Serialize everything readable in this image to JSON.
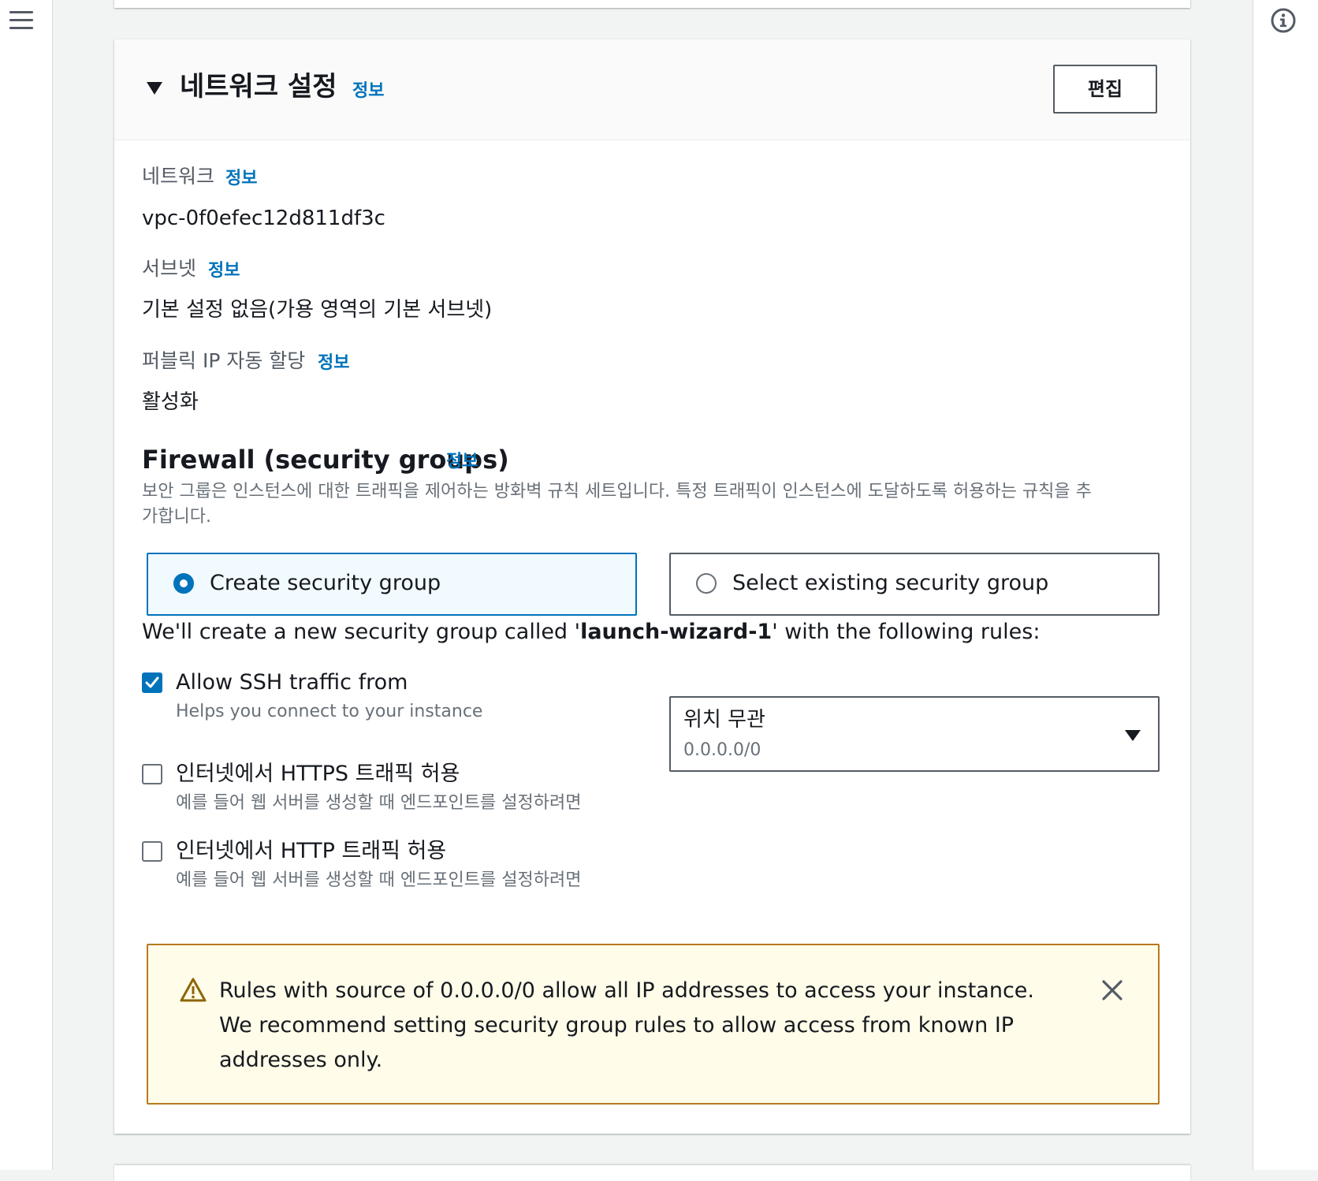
{
  "nav": {
    "menu_icon": "hamburger-menu-icon",
    "info_icon": "info-circle-icon"
  },
  "section": {
    "title": "네트워크 설정",
    "info_link": "정보",
    "edit_label": "편집"
  },
  "fields": {
    "network": {
      "label": "네트워크",
      "info": "정보",
      "value": "vpc-0f0efec12d811df3c"
    },
    "subnet": {
      "label": "서브넷",
      "info": "정보",
      "value": "기본 설정 없음(가용 영역의 기본 서브넷)"
    },
    "public_ip": {
      "label": "퍼블릭 IP 자동 할당",
      "info": "정보",
      "value": "활성화"
    }
  },
  "firewall": {
    "title": "Firewall (security groups)",
    "info": "정보",
    "description": "보안 그룹은 인스턴스에 대한 트래픽을 제어하는 방화벽 규칙 세트입니다. 특정 트래픽이 인스턴스에 도달하도록 허용하는 규칙을 추가합니다.",
    "options": {
      "create": {
        "label": "Create security group",
        "selected": true
      },
      "existing": {
        "label": "Select existing security group",
        "selected": false
      }
    },
    "intro": {
      "prefix": "We'll create a new security group called '",
      "group_name": "launch-wizard-1",
      "suffix": "' with the following rules:"
    },
    "rules": {
      "ssh": {
        "label": "Allow SSH traffic from",
        "description": "Helps you connect to your instance",
        "checked": true
      },
      "https": {
        "label": "인터넷에서 HTTPS 트래픽 허용",
        "description": "예를 들어 웹 서버를 생성할 때 엔드포인트를 설정하려면",
        "checked": false
      },
      "http": {
        "label": "인터넷에서 HTTP 트래픽 허용",
        "description": "예를 들어 웹 서버를 생성할 때 엔드포인트를 설정하려면",
        "checked": false
      }
    },
    "ssh_source": {
      "selected": "위치 무관",
      "cidr": "0.0.0.0/0"
    },
    "warning": {
      "icon": "warning-triangle-icon",
      "text": "Rules with source of 0.0.0.0/0 allow all IP addresses to access your instance. We recommend setting security group rules to allow access from known IP addresses only.",
      "close_icon": "close-icon"
    }
  },
  "colors": {
    "link": "#0073bb",
    "selected_bg": "#f1faff",
    "warning_bg": "#fffce9",
    "warning_border": "#b7791f",
    "page_bg": "#f2f3f3"
  }
}
